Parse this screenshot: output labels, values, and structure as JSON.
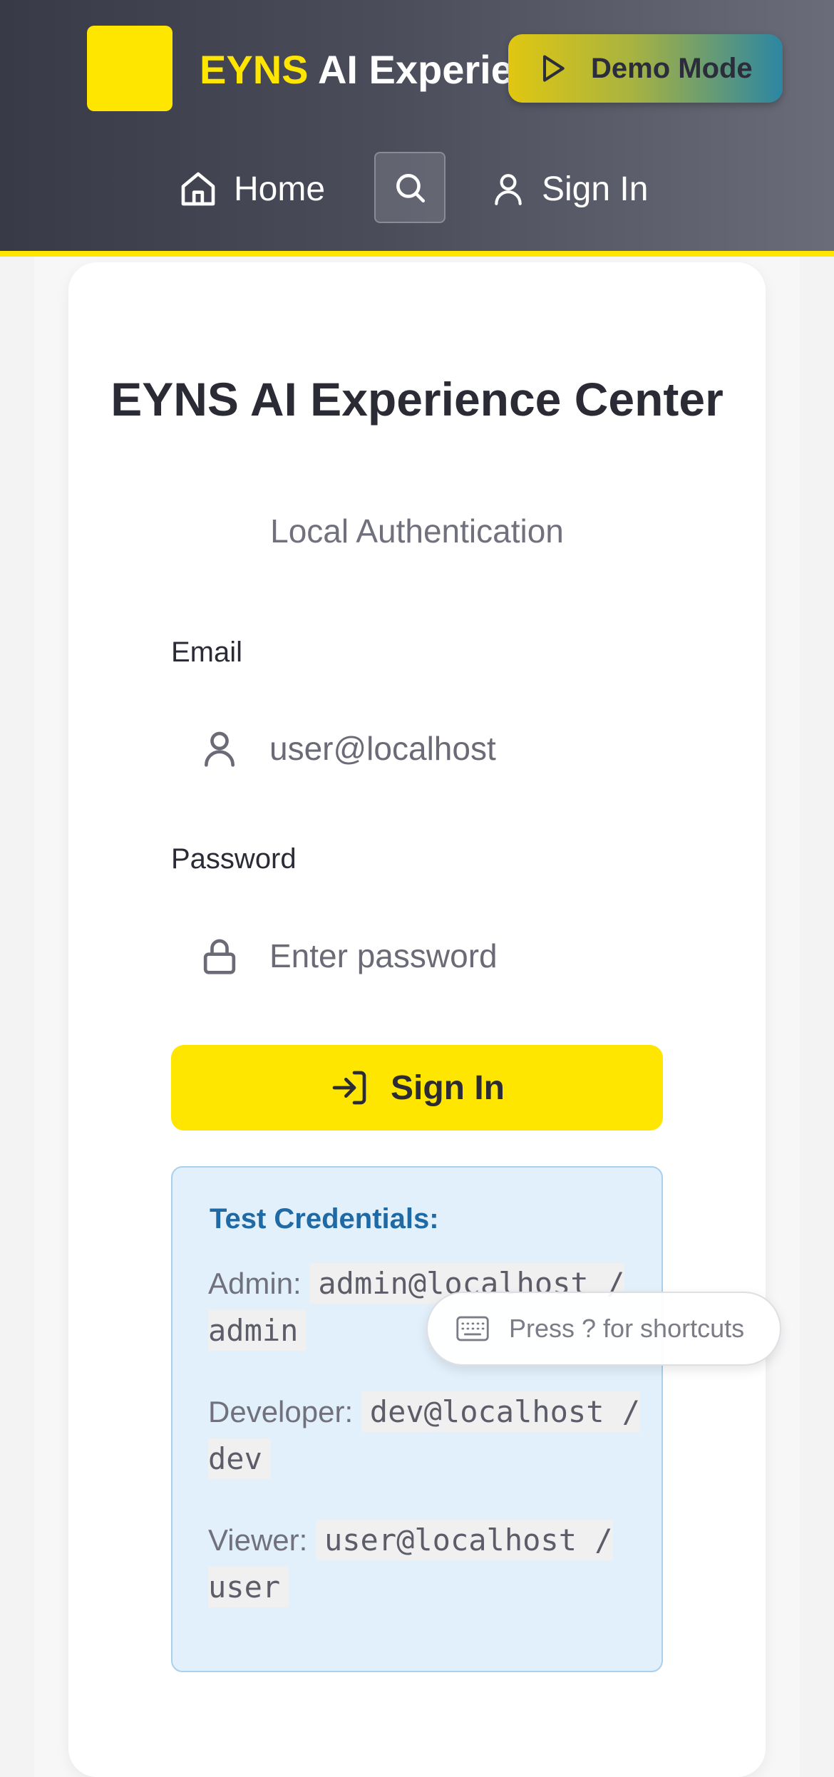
{
  "header": {
    "brand_accent": "EYNS",
    "brand_rest": " AI Experience Center",
    "demo_label": "Demo Mode",
    "nav": {
      "home_label": "Home",
      "signin_label": "Sign In"
    }
  },
  "login": {
    "title": "EYNS AI Experience Center",
    "subtitle": "Local Authentication",
    "email_label": "Email",
    "email_value": "user@localhost",
    "password_label": "Password",
    "password_placeholder": "Enter password",
    "submit_label": "Sign In"
  },
  "credentials": {
    "title": "Test Credentials:",
    "rows": [
      {
        "role": "Admin:",
        "value": "admin@localhost / admin"
      },
      {
        "role": "Developer:",
        "value": "dev@localhost / dev"
      },
      {
        "role": "Viewer:",
        "value": "user@localhost / user"
      }
    ]
  },
  "shortcut_hint": "Press ? for shortcuts",
  "icons": {
    "logo": "logo-square",
    "demo": "play-icon",
    "home": "home-icon",
    "search": "search-icon",
    "signin_nav": "user-icon",
    "email": "user-icon",
    "password": "lock-icon",
    "submit": "log-in-icon",
    "shortcut": "keyboard-icon"
  },
  "colors": {
    "accent": "#ffe600",
    "header_dark": "#383a48",
    "info_blue": "#1f6aa5",
    "info_bg": "#e2f0fb"
  }
}
